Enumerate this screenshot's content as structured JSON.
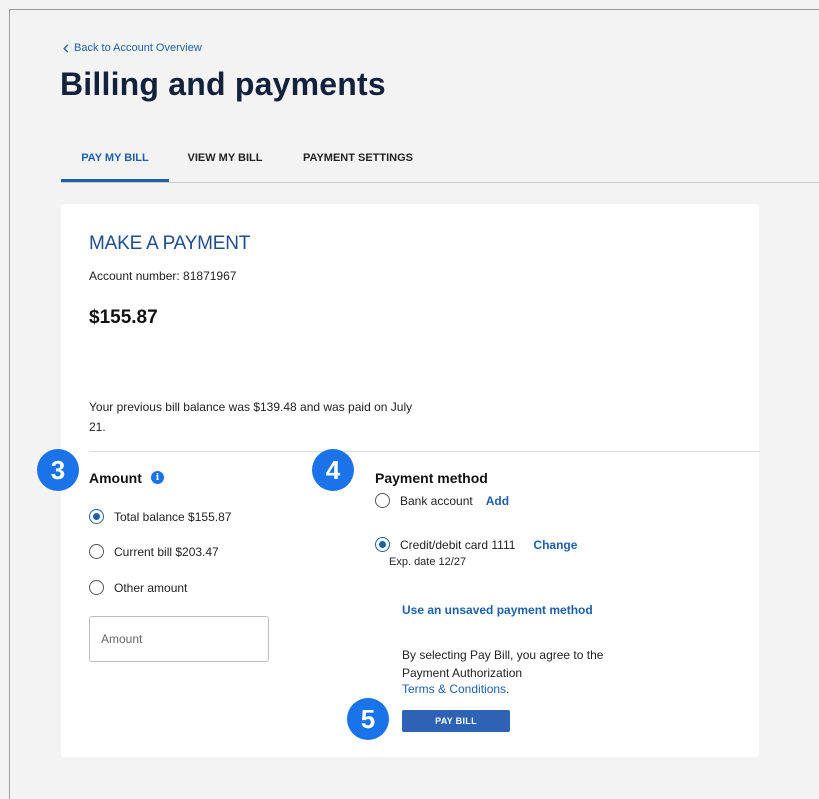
{
  "back_link": "Back to Account Overview",
  "title": "Billing and payments",
  "tabs": [
    {
      "label": "PAY MY BILL",
      "active": true
    },
    {
      "label": "VIEW MY BILL",
      "active": false
    },
    {
      "label": "PAYMENT SETTINGS",
      "active": false
    }
  ],
  "payment": {
    "heading": "MAKE A PAYMENT",
    "account_number": "Account number: 81871967",
    "amount_due": "$155.87",
    "previous_bill_note": "Your previous bill balance was $139.48 and was paid on July 21."
  },
  "steps": {
    "amount": "3",
    "method": "4",
    "pay": "5"
  },
  "amount_section": {
    "title": "Amount",
    "info_icon": "i",
    "options": [
      {
        "label": "Total balance $155.87",
        "checked": true
      },
      {
        "label": "Current bill $203.47",
        "checked": false
      },
      {
        "label": "Other amount",
        "checked": false
      }
    ],
    "input_placeholder": "Amount"
  },
  "method_section": {
    "title": "Payment method",
    "bank_label": "Bank account",
    "bank_action": "Add",
    "card_label": "Credit/debit card 1111",
    "card_action": "Change",
    "card_expiry": "Exp. date 12/27",
    "unsaved_link": "Use an unsaved payment method",
    "agreement": "By selecting Pay Bill, you agree to the Payment Authorization",
    "terms_link": "Terms & Conditions",
    "pay_button": "PAY BILL"
  },
  "colors": {
    "accent": "#1f5fa8",
    "step_badge": "#1a73e8",
    "page_bg": "#f3f3f3"
  }
}
